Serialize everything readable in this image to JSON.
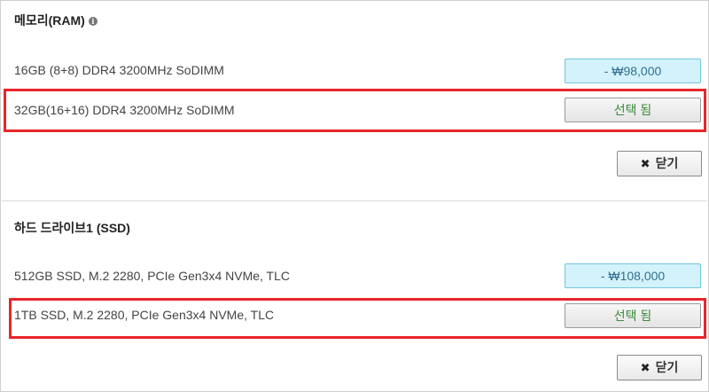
{
  "ram_section": {
    "title": "메모리(RAM)",
    "info_icon": "i",
    "options": [
      {
        "label": "16GB (8+8) DDR4 3200MHz SoDIMM",
        "button": "- ₩98,000"
      },
      {
        "label": "32GB(16+16) DDR4 3200MHz SoDIMM",
        "button": "선택 됨"
      }
    ],
    "close_icon": "✖",
    "close_label": "닫기"
  },
  "ssd_section": {
    "title": "하드 드라이브1 (SSD)",
    "options": [
      {
        "label": "512GB SSD, M.2 2280, PCIe Gen3x4 NVMe, TLC",
        "button": "- ₩108,000"
      },
      {
        "label": "1TB SSD, M.2 2280, PCIe Gen3x4 NVMe, TLC",
        "button": "선택 됨"
      }
    ],
    "close_icon": "✖",
    "close_label": "닫기"
  },
  "colors": {
    "highlight": "#e8262b",
    "price_button_bg": "#d4f2fb",
    "selected_text": "#3c8a3c"
  }
}
